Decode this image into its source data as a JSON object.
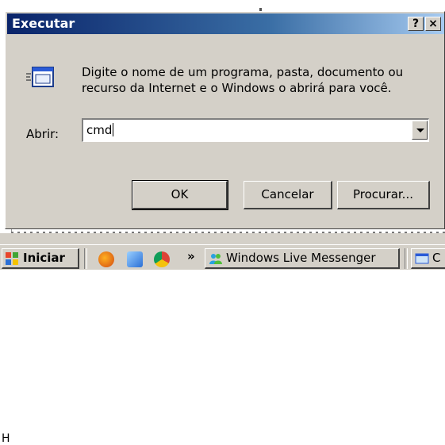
{
  "dialog": {
    "title": "Executar",
    "help_button": "?",
    "close_button": "×",
    "description": "Digite o nome de um programa, pasta, documento ou recurso da Internet e o Windows o abrirá para você.",
    "open_label": "Abrir:",
    "open_value": "cmd",
    "ok_label": "OK",
    "cancel_label": "Cancelar",
    "browse_label": "Procurar..."
  },
  "background": {
    "left_letter": "H"
  },
  "taskbar": {
    "start_label": "Iniciar",
    "quick_launch_overflow": "»",
    "quick_launch_icons": [
      "firefox-icon",
      "messenger-icon",
      "chrome-icon"
    ],
    "tasks": [
      {
        "label": "Windows Live Messenger",
        "icon": "messenger-people-icon"
      },
      {
        "label": "C",
        "icon": "window-icon"
      }
    ]
  },
  "colors": {
    "titlebar_start": "#0a246a",
    "titlebar_end": "#a6caf0",
    "face": "#d4d0c8"
  }
}
